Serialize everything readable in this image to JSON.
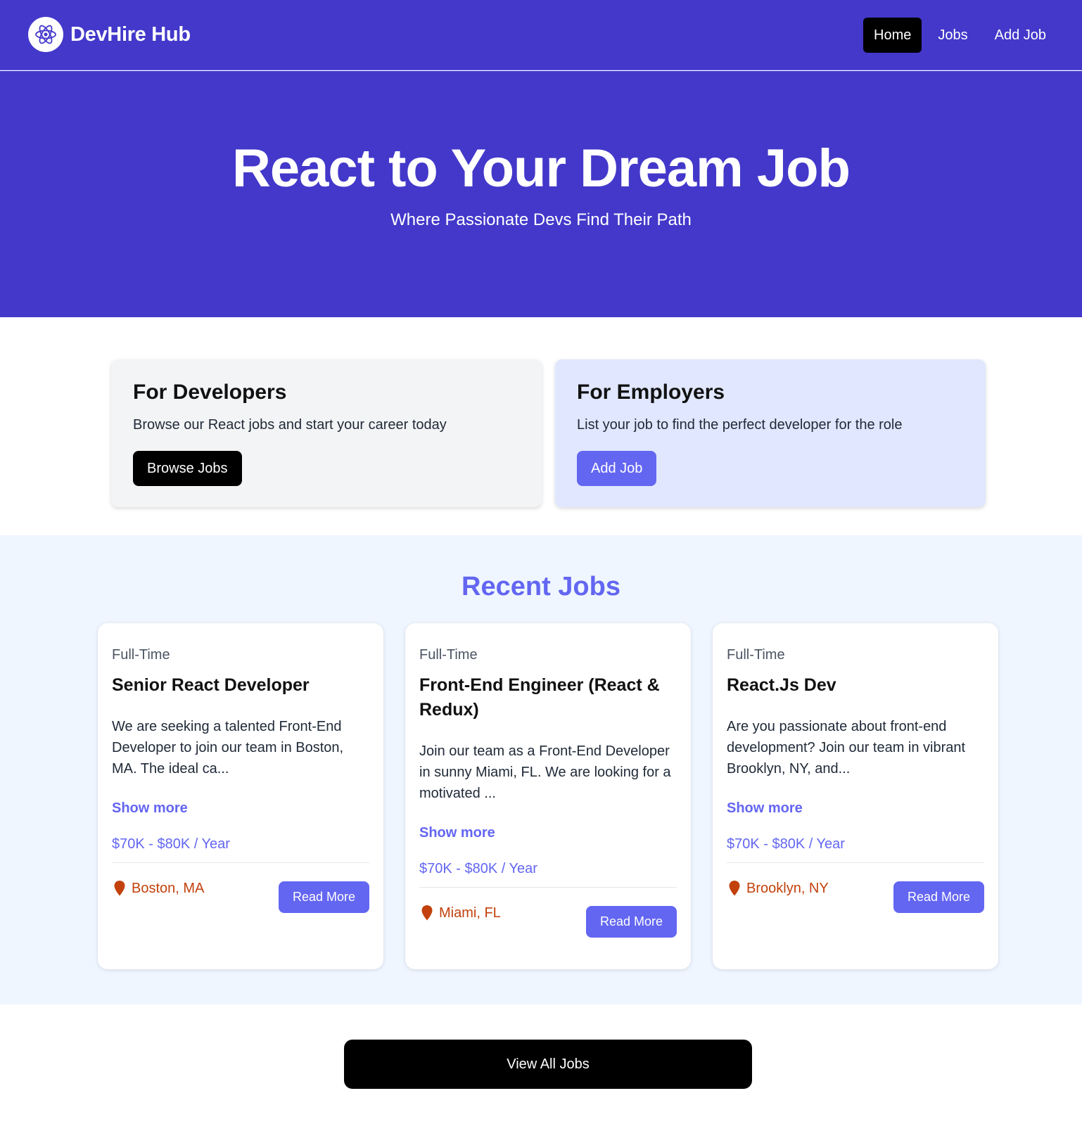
{
  "brand": {
    "name": "DevHire Hub",
    "logo_icon": "react-atom-icon"
  },
  "nav": {
    "items": [
      {
        "label": "Home",
        "active": true
      },
      {
        "label": "Jobs",
        "active": false
      },
      {
        "label": "Add Job",
        "active": false
      }
    ]
  },
  "hero": {
    "title": "React to Your Dream Job",
    "subtitle": "Where Passionate Devs Find Their Path"
  },
  "intro": {
    "developers": {
      "title": "For Developers",
      "text": "Browse our React jobs and start your career today",
      "button": "Browse Jobs"
    },
    "employers": {
      "title": "For Employers",
      "text": "List your job to find the perfect developer for the role",
      "button": "Add Job"
    }
  },
  "recent": {
    "title": "Recent Jobs",
    "jobs": [
      {
        "type": "Full-Time",
        "title": "Senior React Developer",
        "description": "We are seeking a talented Front-End Developer to join our team in Boston, MA. The ideal ca...",
        "show_more": "Show more",
        "salary": "$70K - $80K / Year",
        "location": "Boston, MA",
        "button": "Read More"
      },
      {
        "type": "Full-Time",
        "title": "Front-End Engineer (React & Redux)",
        "description": "Join our team as a Front-End Developer in sunny Miami, FL. We are looking for a motivated ...",
        "show_more": "Show more",
        "salary": "$70K - $80K / Year",
        "location": "Miami, FL",
        "button": "Read More"
      },
      {
        "type": "Full-Time",
        "title": "React.Js Dev",
        "description": "Are you passionate about front-end development? Join our team in vibrant Brooklyn, NY, and...",
        "show_more": "Show more",
        "salary": "$70K - $80K / Year",
        "location": "Brooklyn, NY",
        "button": "Read More"
      }
    ]
  },
  "view_all": {
    "label": "View All Jobs"
  },
  "colors": {
    "primary": "#4338ca",
    "accent": "#6366f1",
    "location": "#c2410c",
    "employer_card": "#e0e7ff",
    "developer_card": "#f3f4f6",
    "recent_bg": "#eff6ff"
  }
}
